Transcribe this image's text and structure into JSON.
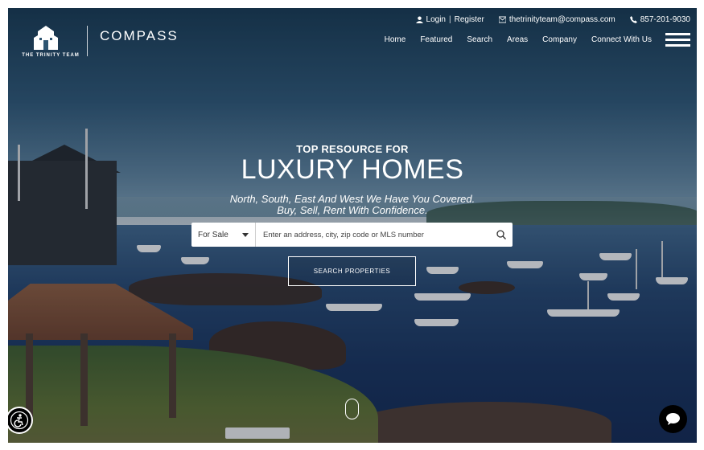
{
  "brand": {
    "team_name": "THE TRINITY TEAM",
    "company": "COMPASS"
  },
  "topbar": {
    "login": "Login",
    "separator": "|",
    "register": "Register",
    "email": "thetrinityteam@compass.com",
    "phone": "857-201-9030"
  },
  "nav": {
    "items": [
      "Home",
      "Featured",
      "Search",
      "Areas",
      "Company",
      "Connect With Us"
    ]
  },
  "hero": {
    "kicker": "TOP RESOURCE FOR",
    "headline": "LUXURY HOMES",
    "tagline_1": "North, South, East And West We Have You Covered.",
    "tagline_2": "Buy, Sell, Rent With Confidence."
  },
  "search": {
    "type_selected": "For Sale",
    "placeholder": "Enter an address, city, zip code or MLS number",
    "button": "SEARCH PROPERTIES"
  },
  "icons": {
    "logo": "houses-logo-icon",
    "user": "user-icon",
    "mail": "mail-icon",
    "phone": "phone-icon",
    "menu": "hamburger-menu-icon",
    "search": "search-icon",
    "accessibility": "accessibility-icon",
    "chat": "chat-bubble-icon",
    "scroll": "scroll-indicator-icon"
  },
  "colors": {
    "accent": "#ffffff",
    "overlay": "#0a192d"
  }
}
